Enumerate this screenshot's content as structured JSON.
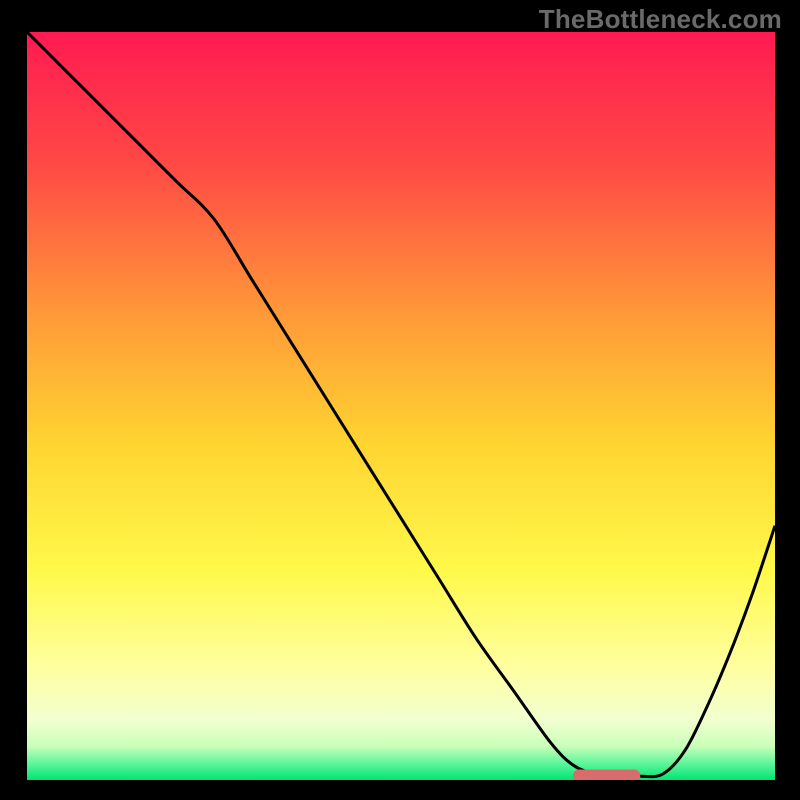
{
  "watermark": "TheBottleneck.com",
  "colors": {
    "top": "#ff1a52",
    "upper_mid": "#ff7a3a",
    "mid": "#ffd431",
    "lower_mid": "#ffff6d",
    "pale": "#f8ffd6",
    "green": "#00e571",
    "curve": "#000000",
    "marker": "#d86c6c"
  },
  "chart_data": {
    "type": "line",
    "title": "",
    "xlabel": "",
    "ylabel": "",
    "xlim": [
      0,
      100
    ],
    "ylim": [
      0,
      100
    ],
    "series": [
      {
        "name": "curve",
        "x": [
          0,
          5,
          10,
          15,
          20,
          25,
          30,
          35,
          40,
          45,
          50,
          55,
          60,
          65,
          70,
          73,
          76,
          79,
          82,
          85,
          88,
          91,
          94,
          97,
          100
        ],
        "y": [
          100,
          95,
          90,
          85,
          80,
          75,
          67,
          59,
          51,
          43,
          35,
          27,
          19,
          12,
          5,
          2,
          0.8,
          0.5,
          0.5,
          0.8,
          4,
          10,
          17,
          25,
          34
        ]
      }
    ],
    "marker": {
      "x_start": 73,
      "x_end": 82,
      "y": 0.6
    },
    "gradient_stops": [
      {
        "offset": 0.0,
        "color": "#ff1a52"
      },
      {
        "offset": 0.18,
        "color": "#ff4a45"
      },
      {
        "offset": 0.38,
        "color": "#ff9a38"
      },
      {
        "offset": 0.55,
        "color": "#ffd431"
      },
      {
        "offset": 0.72,
        "color": "#fff94a"
      },
      {
        "offset": 0.85,
        "color": "#ffffa0"
      },
      {
        "offset": 0.92,
        "color": "#f2ffd0"
      },
      {
        "offset": 0.955,
        "color": "#c8ffb8"
      },
      {
        "offset": 0.975,
        "color": "#6bf7a0"
      },
      {
        "offset": 1.0,
        "color": "#00e571"
      }
    ]
  }
}
